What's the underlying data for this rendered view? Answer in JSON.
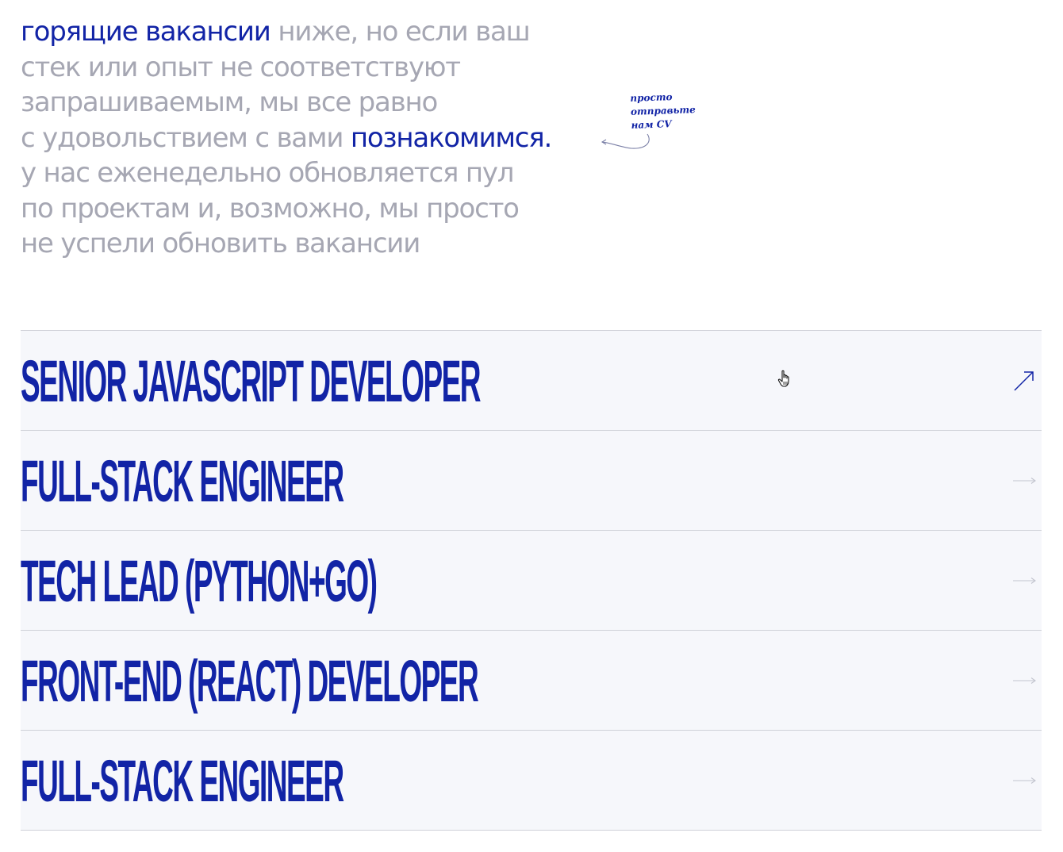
{
  "intro": {
    "lines": [
      [
        {
          "text": "горящие вакансии",
          "accent": true
        },
        {
          "text": " ниже, но если ваш",
          "accent": false
        }
      ],
      [
        {
          "text": "стек или опыт не соответствуют",
          "accent": false
        }
      ],
      [
        {
          "text": "запрашиваемым, мы все равно",
          "accent": false
        }
      ],
      [
        {
          "text": "с удовольствием с вами ",
          "accent": false
        },
        {
          "text": "познакомимся.",
          "accent": true
        }
      ],
      [
        {
          "text": "у нас еженедельно обновляется пул",
          "accent": false
        }
      ],
      [
        {
          "text": "по проектам и, возможно, мы просто",
          "accent": false
        }
      ],
      [
        {
          "text": "не успели обновить вакансии",
          "accent": false
        }
      ]
    ]
  },
  "note": {
    "lines": [
      "просто",
      "отправьте",
      "нам CV"
    ]
  },
  "jobs": [
    {
      "title": "SENIOR JAVASCRIPT DEVELOPER",
      "arrow": "arrow-up-right-icon",
      "active": true
    },
    {
      "title": "FULL-STACK ENGINEER",
      "arrow": "arrow-right-icon",
      "active": false
    },
    {
      "title": "TECH LEAD (PYTHON+GO)",
      "arrow": "arrow-right-icon",
      "active": false
    },
    {
      "title": "FRONT-END (REACT) DEVELOPER",
      "arrow": "arrow-right-icon",
      "active": false
    },
    {
      "title": "FULL-STACK ENGINEER",
      "arrow": "arrow-right-icon",
      "active": false
    }
  ],
  "colors": {
    "accent": "#1224a6",
    "muted_text": "#a6a7b3",
    "row_background": "#f6f7fb",
    "divider": "#cfd1d8",
    "arrow_inactive": "#c3c5cf"
  },
  "cursor": "hand-pointer-icon"
}
